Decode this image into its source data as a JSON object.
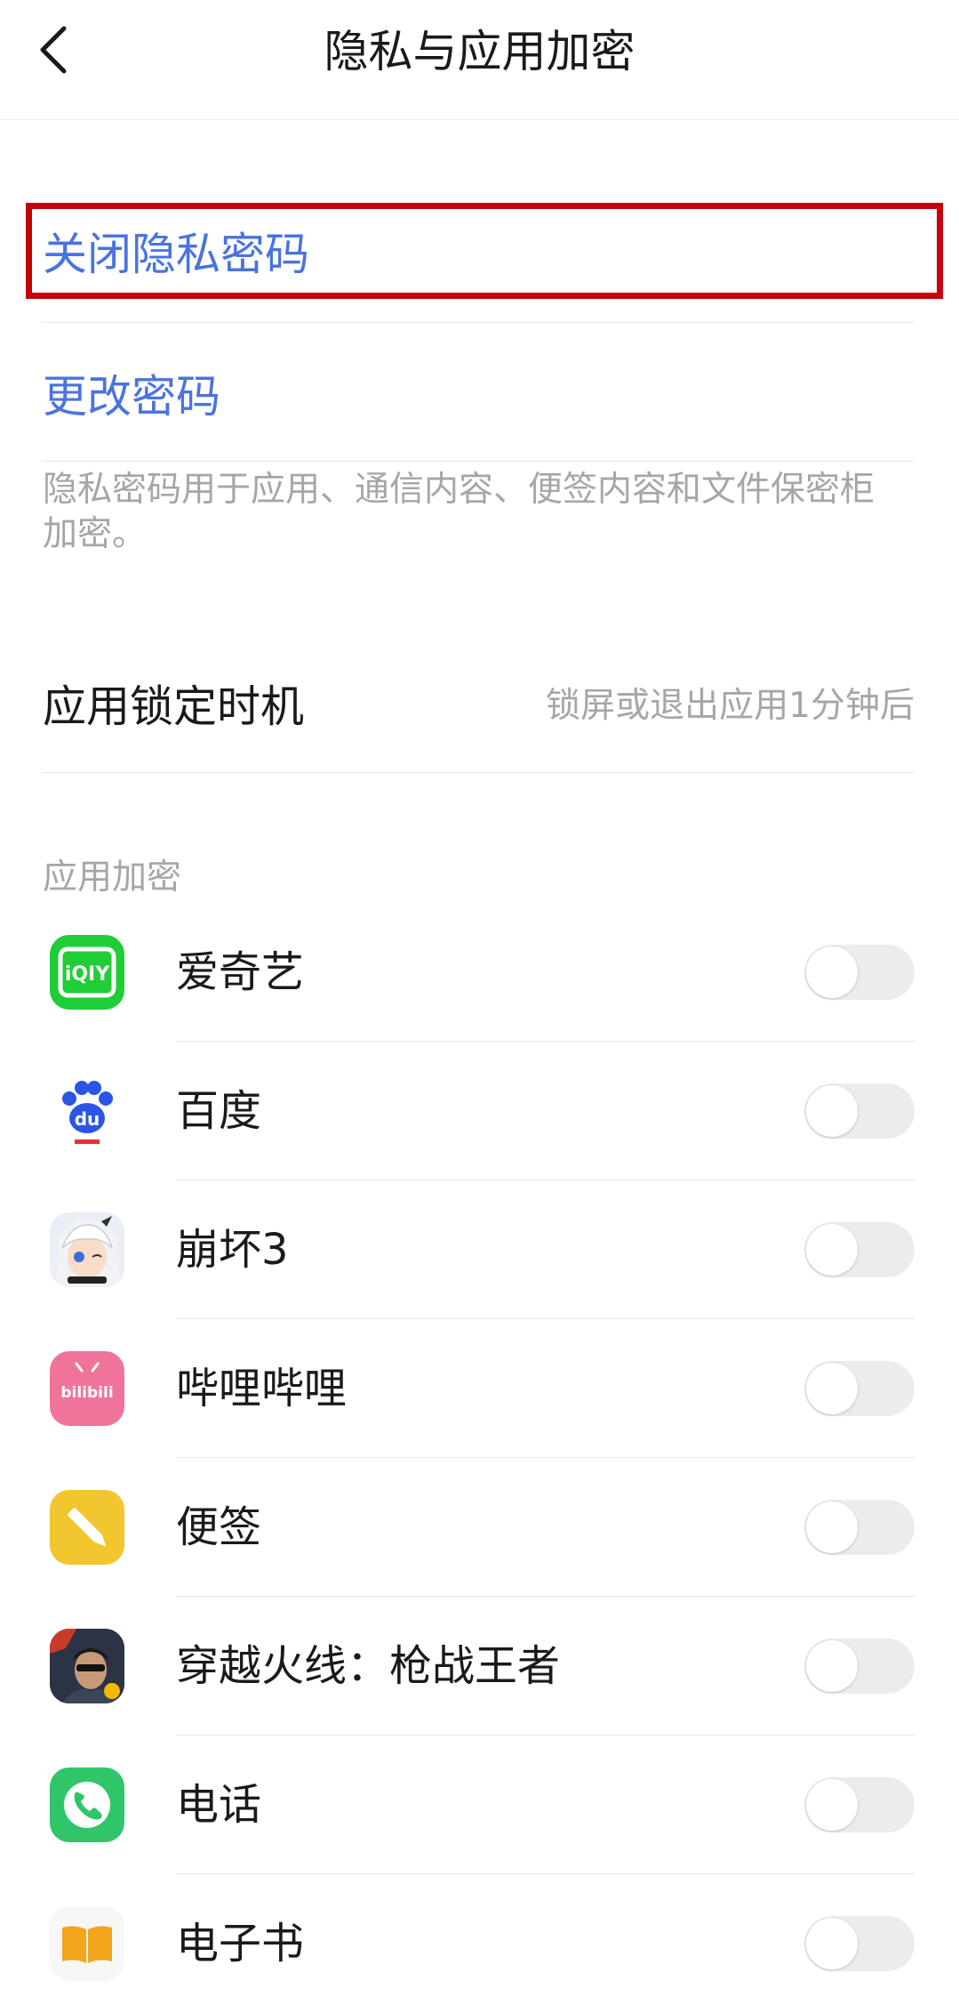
{
  "header": {
    "title": "隐私与应用加密",
    "back_icon": "chevron-left-icon"
  },
  "privacy": {
    "close_password": "关闭隐私密码",
    "change_password": "更改密码",
    "description": "隐私密码用于应用、通信内容、便签内容和文件保密柜加密。",
    "link_color": "#4a73e0",
    "highlight_color": "#c5000c"
  },
  "lock_timing": {
    "label": "应用锁定时机",
    "value": "锁屏或退出应用1分钟后"
  },
  "app_section": {
    "title": "应用加密",
    "apps": [
      {
        "name": "爱奇艺",
        "icon": "iqiyi-icon",
        "enabled": false
      },
      {
        "name": "百度",
        "icon": "baidu-icon",
        "enabled": false
      },
      {
        "name": "崩坏3",
        "icon": "honkai3-icon",
        "enabled": false
      },
      {
        "name": "哔哩哔哩",
        "icon": "bilibili-icon",
        "enabled": false
      },
      {
        "name": "便签",
        "icon": "notes-icon",
        "enabled": false
      },
      {
        "name": "穿越火线：枪战王者",
        "icon": "crossfire-icon",
        "enabled": false
      },
      {
        "name": "电话",
        "icon": "phone-icon",
        "enabled": false
      },
      {
        "name": "电子书",
        "icon": "ebook-icon",
        "enabled": false
      }
    ],
    "icon_texts": {
      "iqiyi": "iQIY",
      "baidu": "du",
      "bilibili": "bilibili"
    }
  }
}
